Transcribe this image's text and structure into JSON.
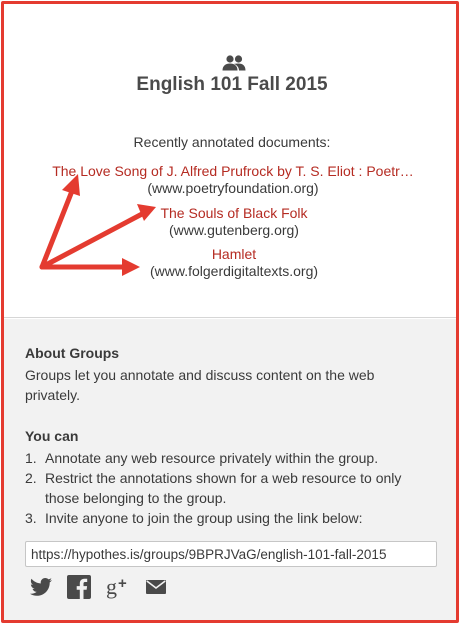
{
  "group": {
    "icon": "group-users-icon",
    "name": "English 101 Fall 2015"
  },
  "recent": {
    "heading": "Recently annotated documents:",
    "documents": [
      {
        "title": "The Love Song of J. Alfred Prufrock by T. S. Eliot : Poetr…",
        "domain": "(www.poetryfoundation.org)"
      },
      {
        "title": "The Souls of Black Folk",
        "domain": "(www.gutenberg.org)"
      },
      {
        "title": "Hamlet",
        "domain": "(www.folgerdigitaltexts.org)"
      }
    ]
  },
  "about": {
    "heading": "About Groups",
    "text": "Groups let you annotate and discuss content on the web privately."
  },
  "you_can": {
    "heading": "You can",
    "items": [
      {
        "num": "1.",
        "text": "Annotate any web resource privately within the group."
      },
      {
        "num": "2.",
        "text": "Restrict the annotations shown for a web resource to only those belonging to the group."
      },
      {
        "num": "3.",
        "text": "Invite anyone to join the group using the link below:"
      }
    ]
  },
  "share": {
    "link": "https://hypothes.is/groups/9BPRJVaG/english-101-fall-2015",
    "icons": [
      "twitter-icon",
      "facebook-icon",
      "google-plus-icon",
      "email-icon"
    ]
  },
  "colors": {
    "border": "#e43b30",
    "link": "#b52b22",
    "arrow": "#e43b30",
    "panel": "#f2f2f2",
    "icon": "#4a4a4a"
  }
}
